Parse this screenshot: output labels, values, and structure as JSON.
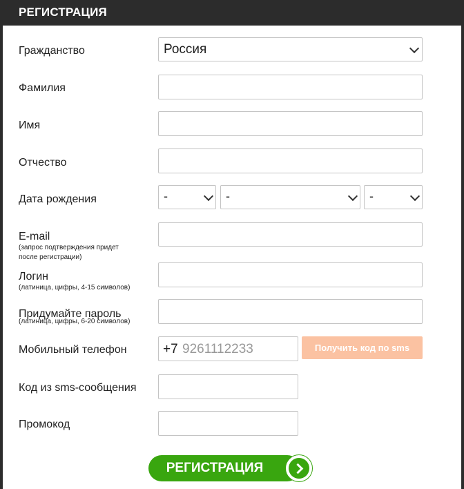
{
  "header": {
    "title": "РЕГИСТРАЦИЯ"
  },
  "form": {
    "citizenship": {
      "label": "Гражданство",
      "value": "Россия"
    },
    "lastname": {
      "label": "Фамилия",
      "value": ""
    },
    "firstname": {
      "label": "Имя",
      "value": ""
    },
    "patronymic": {
      "label": "Отчество",
      "value": ""
    },
    "birthdate": {
      "label": "Дата рождения",
      "day": "-",
      "month": "-",
      "year": "-"
    },
    "email": {
      "label": "E-mail",
      "hint_line1": "(запрос подтверждения придет",
      "hint_line2": "после регистрации)",
      "value": ""
    },
    "login": {
      "label": "Логин",
      "hint": "(латиница, цифры, 4-15 символов)",
      "value": ""
    },
    "password": {
      "label": "Придумайте пароль",
      "hint": "(латиница, цифры, 6-20 символов)",
      "value": ""
    },
    "phone": {
      "label": "Мобильный телефон",
      "prefix": "+7",
      "placeholder": "9261112233",
      "sms_button": "Получить код по sms"
    },
    "sms_code": {
      "label": "Код из sms-сообщения",
      "value": ""
    },
    "promo": {
      "label": "Промокод",
      "value": ""
    },
    "submit": {
      "label": "РЕГИСТРАЦИЯ"
    }
  },
  "colors": {
    "header_bg": "#2c2c2c",
    "sms_button_bg": "#fbc2a2",
    "submit_bg": "#39a60f"
  }
}
